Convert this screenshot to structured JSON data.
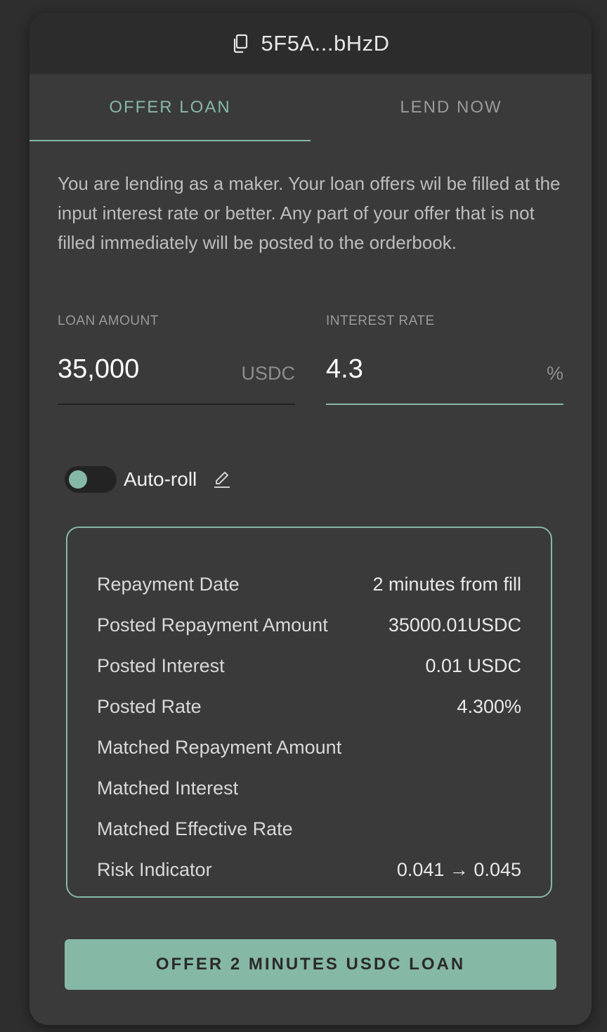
{
  "header": {
    "wallet_address": "5F5A...bHzD",
    "icon": "copy-icon"
  },
  "tabs": [
    {
      "label": "OFFER LOAN",
      "active": true
    },
    {
      "label": "LEND NOW",
      "active": false
    }
  ],
  "description": "You are lending as a maker. Your loan offers wil be filled at the input interest rate or better. Any part of your offer that is not filled immediately will be posted to the orderbook.",
  "loan_amount": {
    "label": "LOAN AMOUNT",
    "value": "35,000",
    "unit": "USDC"
  },
  "interest_rate": {
    "label": "INTEREST RATE",
    "value": "4.3",
    "unit": "%"
  },
  "autoroll": {
    "label": "Auto-roll",
    "enabled": false,
    "edit_icon": "pencil-icon"
  },
  "summary": {
    "rows": [
      {
        "label": "Repayment Date",
        "value": "2 minutes from fill"
      },
      {
        "label": "Posted Repayment Amount",
        "value": "35000.01USDC"
      },
      {
        "label": "Posted Interest",
        "value": "0.01 USDC"
      },
      {
        "label": "Posted Rate",
        "value": "4.300%"
      },
      {
        "label": "Matched Repayment Amount",
        "value": ""
      },
      {
        "label": "Matched Interest",
        "value": ""
      },
      {
        "label": "Matched Effective Rate",
        "value": ""
      },
      {
        "label": "Risk Indicator",
        "value": "0.041 → 0.045"
      }
    ]
  },
  "submit": {
    "label": "OFFER 2 MINUTES USDC LOAN"
  },
  "colors": {
    "accent": "#86b8a6",
    "panel": "#3a3a3a",
    "header": "#2c2c2c",
    "background": "#2e2e2e"
  }
}
